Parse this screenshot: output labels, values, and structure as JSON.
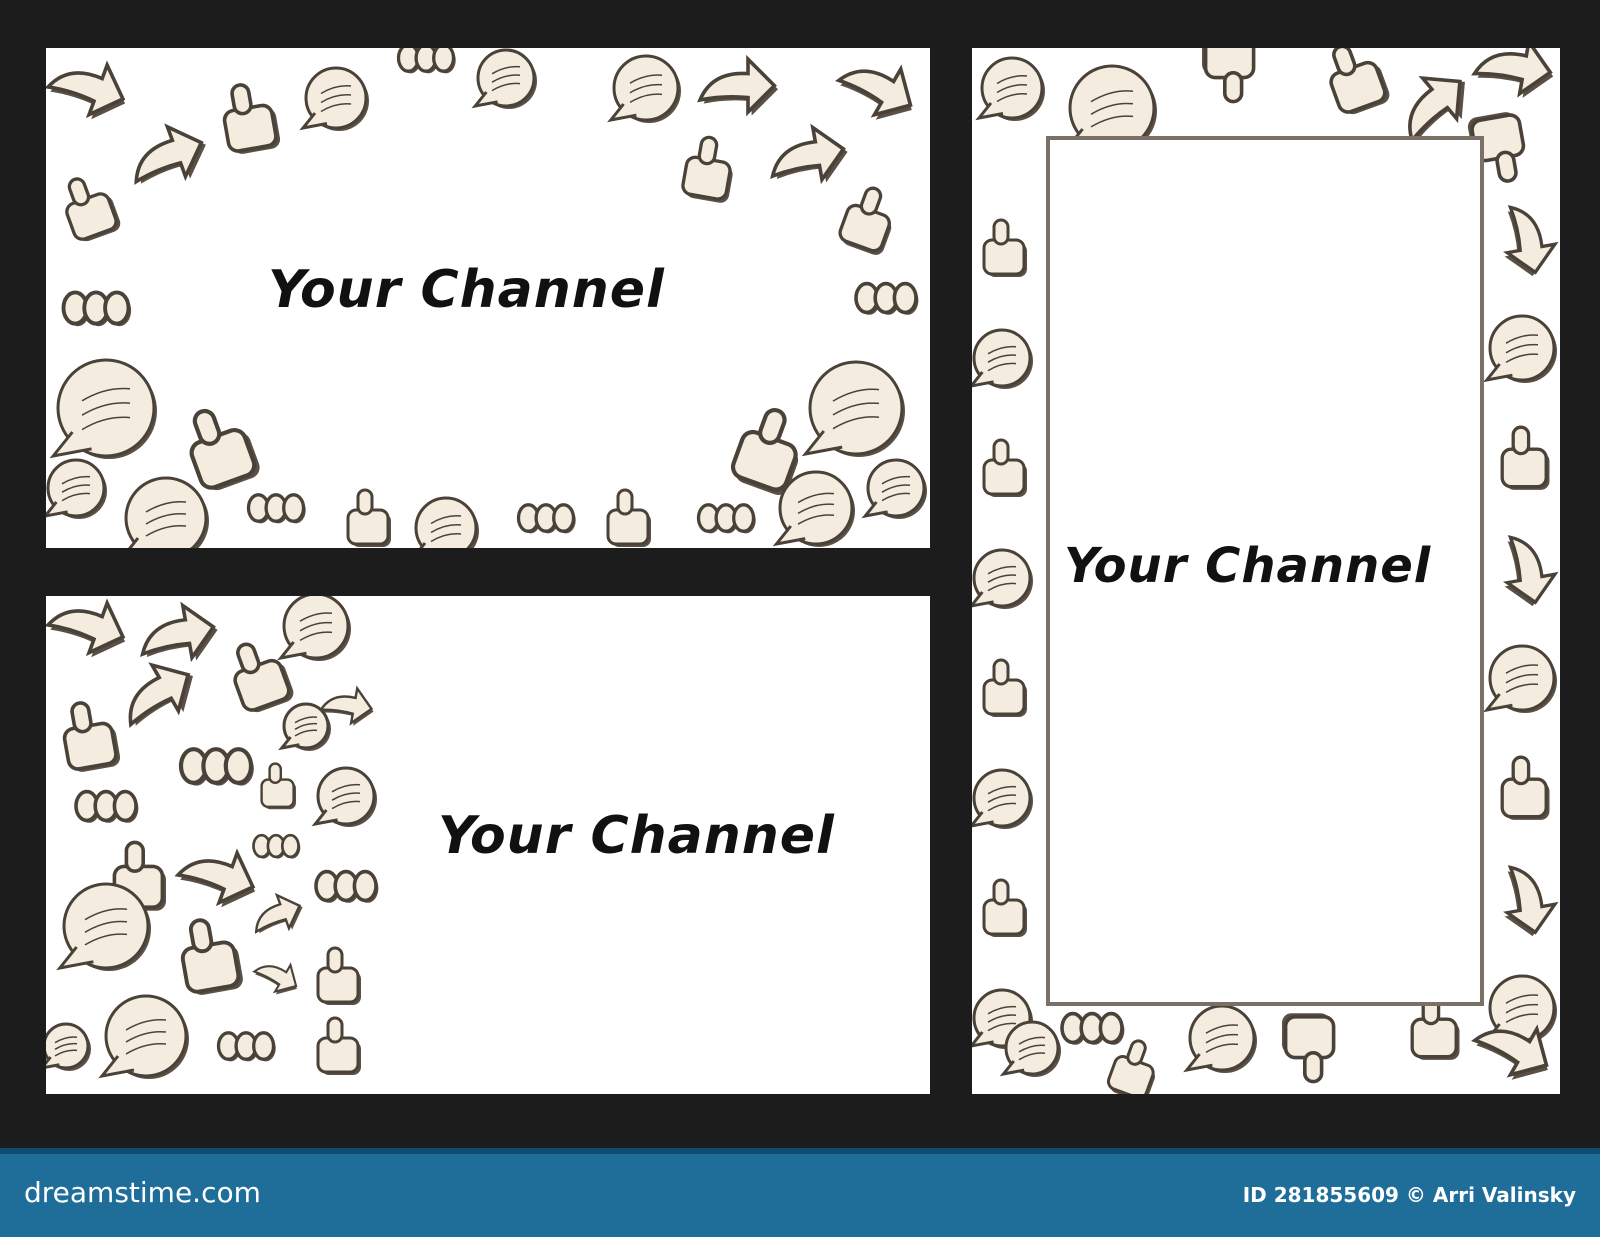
{
  "cards": [
    {
      "id": "top-left",
      "title": "Your Channel"
    },
    {
      "id": "bottom-left",
      "title": "Your Channel"
    },
    {
      "id": "right",
      "title": "Your Channel"
    }
  ],
  "footer": {
    "brand": "dreamstime.com",
    "credit": "ID 281855609 © Arri Valinsky"
  },
  "colors": {
    "stickers": "#f3ecdf",
    "outline": "#4a4238",
    "background": "#1c1c1c",
    "footer": "#1f6e9a"
  },
  "icons": [
    "thumbs-up-icon",
    "thumbs-down-icon",
    "speech-bubble-icon",
    "arrow-icon"
  ]
}
